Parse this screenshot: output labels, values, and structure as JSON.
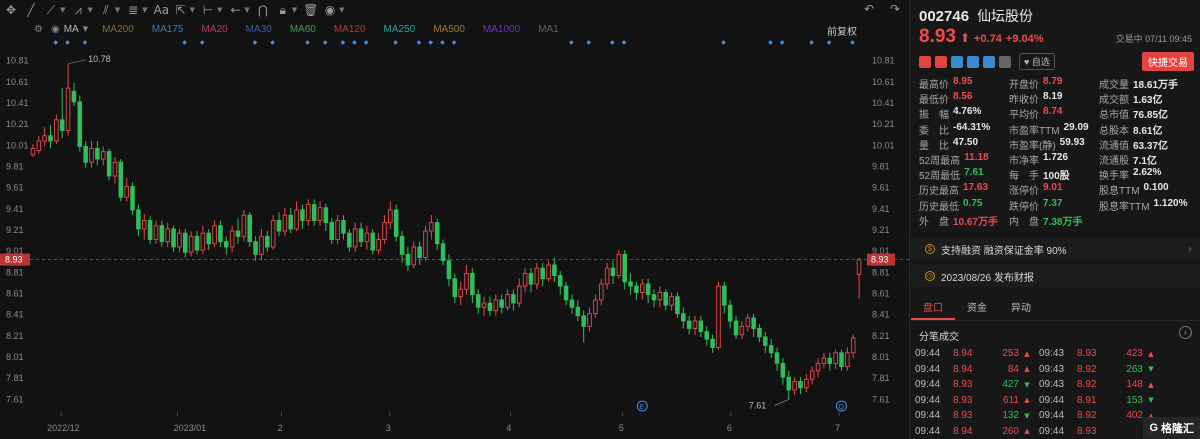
{
  "toolbar": {
    "icons": [
      "crosshair-move-icon",
      "line-icon",
      "ray-icon",
      "polyline-icon",
      "parallel-icon",
      "fib-icon",
      "text-aa-icon",
      "scale-icon",
      "measure-icon",
      "arrow-left-icon",
      "magnet-icon",
      "lock-icon",
      "trash-icon",
      "eye-icon",
      "undo-icon",
      "redo-icon"
    ],
    "text_tool": "Aa"
  },
  "ma_bar": {
    "label": "MA",
    "items": [
      {
        "label": "MA200",
        "color": "#8a6a2c"
      },
      {
        "label": "MA175",
        "color": "#3a7ab0"
      },
      {
        "label": "MA20",
        "color": "#b23a6a"
      },
      {
        "label": "MA30",
        "color": "#3a5ab0"
      },
      {
        "label": "MA60",
        "color": "#3aa05a"
      },
      {
        "label": "MA120",
        "color": "#b23a3a"
      },
      {
        "label": "MA250",
        "color": "#2aa0a0"
      },
      {
        "label": "MA500",
        "color": "#a07a2a"
      },
      {
        "label": "MA1000",
        "color": "#6a3ab0"
      },
      {
        "label": "MA1",
        "color": "#606060"
      }
    ],
    "adjust": "前复权"
  },
  "quote": {
    "code": "002746",
    "name": "仙坛股份",
    "price": "8.93",
    "change": "+0.74",
    "change_pct": "+9.04%",
    "status": "交易中 07/11 09:45",
    "watch_label": "自选",
    "quick_trade": "快捷交易",
    "tag_colors": [
      "#e34343",
      "#e34343",
      "#3a8ad0",
      "#3a8ad0",
      "#3a8ad0",
      "#666666"
    ]
  },
  "stats": [
    [
      {
        "label": "最高价",
        "value": "8.95",
        "color": "red"
      },
      {
        "label": "开盘价",
        "value": "8.79",
        "color": "red"
      },
      {
        "label": "成交量",
        "value": "18.61万手",
        "color": ""
      }
    ],
    [
      {
        "label": "最低价",
        "value": "8.56",
        "color": "red"
      },
      {
        "label": "昨收价",
        "value": "8.19",
        "color": ""
      },
      {
        "label": "成交额",
        "value": "1.63亿",
        "color": ""
      }
    ],
    [
      {
        "label": "振　幅",
        "value": "4.76%",
        "color": ""
      },
      {
        "label": "平均价",
        "value": "8.74",
        "color": "red"
      },
      {
        "label": "总市值",
        "value": "76.85亿",
        "color": ""
      }
    ],
    [
      {
        "label": "委　比",
        "value": "-64.31%",
        "color": ""
      },
      {
        "label": "市盈率TTM",
        "value": "29.09",
        "color": ""
      },
      {
        "label": "总股本",
        "value": "8.61亿",
        "color": ""
      }
    ],
    [
      {
        "label": "量　比",
        "value": "47.50",
        "color": ""
      },
      {
        "label": "市盈率(静)",
        "value": "59.93",
        "color": ""
      },
      {
        "label": "流通值",
        "value": "63.37亿",
        "color": ""
      }
    ],
    [
      {
        "label": "52周最高",
        "value": "11.18",
        "color": "red"
      },
      {
        "label": "市净率",
        "value": "1.726",
        "color": ""
      },
      {
        "label": "流通股",
        "value": "7.1亿",
        "color": ""
      }
    ],
    [
      {
        "label": "52周最低",
        "value": "7.61",
        "color": "green"
      },
      {
        "label": "每　手",
        "value": "100股",
        "color": ""
      },
      {
        "label": "换手率",
        "value": "2.62%",
        "color": ""
      }
    ],
    [
      {
        "label": "历史最高",
        "value": "17.63",
        "color": "red"
      },
      {
        "label": "涨停价",
        "value": "9.01",
        "color": "red"
      },
      {
        "label": "股息TTM",
        "value": "0.100",
        "color": ""
      }
    ],
    [
      {
        "label": "历史最低",
        "value": "0.75",
        "color": "green"
      },
      {
        "label": "跌停价",
        "value": "7.37",
        "color": "green"
      },
      {
        "label": "股息率TTM",
        "value": "1.120%",
        "color": ""
      }
    ],
    [
      {
        "label": "外　盘",
        "value": "10.67万手",
        "color": "red"
      },
      {
        "label": "内　盘",
        "value": "7.38万手",
        "color": "green"
      },
      {
        "label": "",
        "value": "",
        "color": ""
      }
    ]
  ],
  "notices": [
    {
      "text": "支持融资 融资保证金率 90%"
    },
    {
      "text": "2023/08/26 发布财报"
    }
  ],
  "tabs": [
    "盘口",
    "资金",
    "异动"
  ],
  "ticks_title": "分笔成交",
  "ticks": [
    {
      "t1": "09:44",
      "p1": "8.94",
      "v1": "253",
      "d1": "up",
      "t2": "09:43",
      "p2": "8.93",
      "v2": "423",
      "d2": "up"
    },
    {
      "t1": "09:44",
      "p1": "8.94",
      "v1": "84",
      "d1": "up",
      "t2": "09:43",
      "p2": "8.92",
      "v2": "263",
      "d2": "down"
    },
    {
      "t1": "09:44",
      "p1": "8.93",
      "v1": "427",
      "d1": "down",
      "t2": "09:43",
      "p2": "8.92",
      "v2": "148",
      "d2": "up"
    },
    {
      "t1": "09:44",
      "p1": "8.93",
      "v1": "611",
      "d1": "up",
      "t2": "09:44",
      "p2": "8.91",
      "v2": "153",
      "d2": "down"
    },
    {
      "t1": "09:44",
      "p1": "8.93",
      "v1": "132",
      "d1": "down",
      "t2": "09:44",
      "p2": "8.92",
      "v2": "402",
      "d2": "up"
    },
    {
      "t1": "09:44",
      "p1": "8.94",
      "v1": "260",
      "d1": "up",
      "t2": "09:44",
      "p2": "8.93",
      "v2": "",
      "d2": "up"
    }
  ],
  "logo": "格隆汇",
  "chart_data": {
    "type": "candlestick",
    "y_ticks": [
      "10.81",
      "10.61",
      "10.41",
      "10.21",
      "10.01",
      "9.81",
      "9.61",
      "9.41",
      "9.21",
      "9.01",
      "8.81",
      "8.61",
      "8.41",
      "8.21",
      "8.01",
      "7.81",
      "7.61"
    ],
    "x_labels": [
      "2022/12",
      "2023/01",
      "2",
      "3",
      "4",
      "5",
      "6",
      "7"
    ],
    "ylim": [
      7.51,
      10.91
    ],
    "current_price": "8.93",
    "max_label": "10.78",
    "min_label": "7.61",
    "event_markers": [
      "E",
      "Q"
    ],
    "candles": [
      [
        9.92,
        9.98,
        9.9,
        10.02
      ],
      [
        9.96,
        10.05,
        9.93,
        10.1
      ],
      [
        10.05,
        10.1,
        10.0,
        10.18
      ],
      [
        10.1,
        10.05,
        9.98,
        10.2
      ],
      [
        10.05,
        10.25,
        10.02,
        10.3
      ],
      [
        10.25,
        10.15,
        10.08,
        10.55
      ],
      [
        10.15,
        10.55,
        10.1,
        10.78
      ],
      [
        10.52,
        10.42,
        10.38,
        10.6
      ],
      [
        10.42,
        10.0,
        9.95,
        10.48
      ],
      [
        10.0,
        9.85,
        9.8,
        10.05
      ],
      [
        9.85,
        9.98,
        9.8,
        10.05
      ],
      [
        9.98,
        9.88,
        9.82,
        10.05
      ],
      [
        9.88,
        9.95,
        9.82,
        10.0
      ],
      [
        9.95,
        9.72,
        9.68,
        9.98
      ],
      [
        9.72,
        9.85,
        9.65,
        9.9
      ],
      [
        9.85,
        9.52,
        9.48,
        9.88
      ],
      [
        9.52,
        9.62,
        9.48,
        9.7
      ],
      [
        9.62,
        9.4,
        9.35,
        9.66
      ],
      [
        9.4,
        9.22,
        9.15,
        9.45
      ],
      [
        9.22,
        9.3,
        9.12,
        9.36
      ],
      [
        9.3,
        9.12,
        9.08,
        9.34
      ],
      [
        9.12,
        9.25,
        9.08,
        9.3
      ],
      [
        9.25,
        9.1,
        9.05,
        9.3
      ],
      [
        9.1,
        9.22,
        9.05,
        9.28
      ],
      [
        9.22,
        9.05,
        9.0,
        9.25
      ],
      [
        9.05,
        9.18,
        9.0,
        9.22
      ],
      [
        9.18,
        9.0,
        8.95,
        9.22
      ],
      [
        9.0,
        9.15,
        8.96,
        9.2
      ],
      [
        9.15,
        9.02,
        8.98,
        9.2
      ],
      [
        9.02,
        9.18,
        8.98,
        9.25
      ],
      [
        9.18,
        9.08,
        9.02,
        9.22
      ],
      [
        9.08,
        9.25,
        9.05,
        9.3
      ],
      [
        9.25,
        9.1,
        9.05,
        9.3
      ],
      [
        9.1,
        9.05,
        8.98,
        9.15
      ],
      [
        9.05,
        9.2,
        9.0,
        9.25
      ],
      [
        9.2,
        9.15,
        9.08,
        9.32
      ],
      [
        9.15,
        9.35,
        9.1,
        9.4
      ],
      [
        9.35,
        9.1,
        9.05,
        9.38
      ],
      [
        9.1,
        8.98,
        8.92,
        9.15
      ],
      [
        8.98,
        9.15,
        8.92,
        9.22
      ],
      [
        9.15,
        9.05,
        9.0,
        9.2
      ],
      [
        9.05,
        9.3,
        9.02,
        9.35
      ],
      [
        9.3,
        9.2,
        9.15,
        9.38
      ],
      [
        9.2,
        9.35,
        9.15,
        9.42
      ],
      [
        9.35,
        9.22,
        9.18,
        9.42
      ],
      [
        9.22,
        9.4,
        9.2,
        9.48
      ],
      [
        9.4,
        9.3,
        9.22,
        9.45
      ],
      [
        9.3,
        9.45,
        9.25,
        9.5
      ],
      [
        9.45,
        9.3,
        9.25,
        9.5
      ],
      [
        9.3,
        9.42,
        9.25,
        9.48
      ],
      [
        9.42,
        9.28,
        9.2,
        9.46
      ],
      [
        9.28,
        9.12,
        9.08,
        9.32
      ],
      [
        9.12,
        9.3,
        9.08,
        9.35
      ],
      [
        9.3,
        9.18,
        9.12,
        9.35
      ],
      [
        9.18,
        9.05,
        9.0,
        9.22
      ],
      [
        9.05,
        9.22,
        9.0,
        9.28
      ],
      [
        9.22,
        9.1,
        9.05,
        9.28
      ],
      [
        9.1,
        9.18,
        9.02,
        9.25
      ],
      [
        9.18,
        9.02,
        8.98,
        9.22
      ],
      [
        9.02,
        9.12,
        8.98,
        9.18
      ],
      [
        9.12,
        9.28,
        9.08,
        9.35
      ],
      [
        9.28,
        9.4,
        9.22,
        9.48
      ],
      [
        9.4,
        9.15,
        9.1,
        9.45
      ],
      [
        9.15,
        8.98,
        8.9,
        9.2
      ],
      [
        8.98,
        8.88,
        8.82,
        9.05
      ],
      [
        8.88,
        9.05,
        8.85,
        9.1
      ],
      [
        9.05,
        8.95,
        8.88,
        9.1
      ],
      [
        8.95,
        9.2,
        8.92,
        9.25
      ],
      [
        9.2,
        9.28,
        9.12,
        9.35
      ],
      [
        9.28,
        9.08,
        9.02,
        9.32
      ],
      [
        9.08,
        8.92,
        8.88,
        9.12
      ],
      [
        8.92,
        8.75,
        8.68,
        8.98
      ],
      [
        8.75,
        8.58,
        8.52,
        8.8
      ],
      [
        8.58,
        8.65,
        8.5,
        8.72
      ],
      [
        8.65,
        8.8,
        8.6,
        8.88
      ],
      [
        8.8,
        8.6,
        8.52,
        8.85
      ],
      [
        8.6,
        8.48,
        8.42,
        8.65
      ],
      [
        8.48,
        8.52,
        8.4,
        8.58
      ],
      [
        8.52,
        8.45,
        8.4,
        8.58
      ],
      [
        8.45,
        8.55,
        8.4,
        8.6
      ],
      [
        8.55,
        8.48,
        8.42,
        8.6
      ],
      [
        8.48,
        8.6,
        8.45,
        8.65
      ],
      [
        8.6,
        8.52,
        8.45,
        8.65
      ],
      [
        8.52,
        8.68,
        8.48,
        8.75
      ],
      [
        8.68,
        8.8,
        8.62,
        8.85
      ],
      [
        8.8,
        8.7,
        8.62,
        8.85
      ],
      [
        8.7,
        8.85,
        8.65,
        8.9
      ],
      [
        8.85,
        8.75,
        8.68,
        8.9
      ],
      [
        8.75,
        8.88,
        8.72,
        8.92
      ],
      [
        8.88,
        8.78,
        8.72,
        8.95
      ],
      [
        8.78,
        8.68,
        8.6,
        8.82
      ],
      [
        8.68,
        8.55,
        8.5,
        8.72
      ],
      [
        8.55,
        8.48,
        8.42,
        8.6
      ],
      [
        8.48,
        8.4,
        8.35,
        8.55
      ],
      [
        8.4,
        8.3,
        8.15,
        8.45
      ],
      [
        8.3,
        8.42,
        8.25,
        8.48
      ],
      [
        8.42,
        8.55,
        8.38,
        8.6
      ],
      [
        8.55,
        8.7,
        8.5,
        8.75
      ],
      [
        8.7,
        8.85,
        8.65,
        8.9
      ],
      [
        8.85,
        8.78,
        8.7,
        8.92
      ],
      [
        8.78,
        8.98,
        8.75,
        9.02
      ],
      [
        8.98,
        8.72,
        8.65,
        9.02
      ],
      [
        8.72,
        8.68,
        8.6,
        8.8
      ],
      [
        8.68,
        8.62,
        8.55,
        8.72
      ],
      [
        8.62,
        8.7,
        8.55,
        8.75
      ],
      [
        8.7,
        8.6,
        8.52,
        8.75
      ],
      [
        8.6,
        8.55,
        8.48,
        8.65
      ],
      [
        8.55,
        8.62,
        8.48,
        8.68
      ],
      [
        8.62,
        8.5,
        8.45,
        8.65
      ],
      [
        8.5,
        8.58,
        8.45,
        8.62
      ],
      [
        8.58,
        8.42,
        8.38,
        8.62
      ],
      [
        8.42,
        8.35,
        8.28,
        8.48
      ],
      [
        8.35,
        8.28,
        8.22,
        8.4
      ],
      [
        8.28,
        8.35,
        8.22,
        8.4
      ],
      [
        8.35,
        8.25,
        8.2,
        8.4
      ],
      [
        8.25,
        8.18,
        8.12,
        8.3
      ],
      [
        8.18,
        8.1,
        8.05,
        8.22
      ],
      [
        8.1,
        8.68,
        8.08,
        8.72
      ],
      [
        8.68,
        8.5,
        8.42,
        8.72
      ],
      [
        8.5,
        8.35,
        8.28,
        8.55
      ],
      [
        8.35,
        8.22,
        8.18,
        8.4
      ],
      [
        8.22,
        8.3,
        8.18,
        8.35
      ],
      [
        8.3,
        8.38,
        8.25,
        8.42
      ],
      [
        8.38,
        8.28,
        8.2,
        8.42
      ],
      [
        8.28,
        8.2,
        8.15,
        8.32
      ],
      [
        8.2,
        8.12,
        8.05,
        8.25
      ],
      [
        8.12,
        8.05,
        8.0,
        8.18
      ],
      [
        8.05,
        7.95,
        7.88,
        8.1
      ],
      [
        7.95,
        7.82,
        7.75,
        8.0
      ],
      [
        7.82,
        7.7,
        7.61,
        7.88
      ],
      [
        7.7,
        7.78,
        7.65,
        7.82
      ],
      [
        7.78,
        7.72,
        7.66,
        7.82
      ],
      [
        7.72,
        7.8,
        7.68,
        7.85
      ],
      [
        7.8,
        7.88,
        7.75,
        7.92
      ],
      [
        7.88,
        7.95,
        7.82,
        8.0
      ],
      [
        7.95,
        8.0,
        7.9,
        8.05
      ],
      [
        8.0,
        7.95,
        7.88,
        8.05
      ],
      [
        7.95,
        8.05,
        7.9,
        8.08
      ],
      [
        8.05,
        7.92,
        7.88,
        8.08
      ],
      [
        7.92,
        8.05,
        7.88,
        8.1
      ],
      [
        8.05,
        8.19,
        8.0,
        8.22
      ],
      [
        8.79,
        8.93,
        8.56,
        8.95
      ]
    ]
  }
}
